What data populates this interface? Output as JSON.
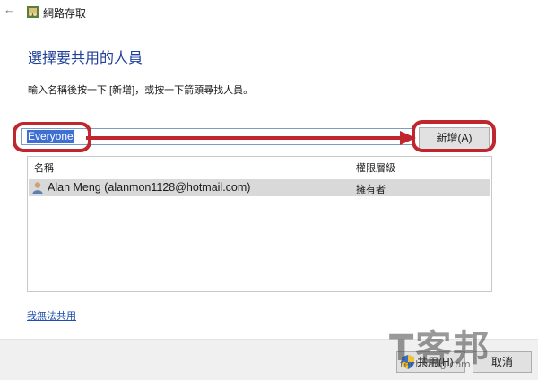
{
  "titlebar": {
    "back_glyph": "←",
    "title": "網路存取"
  },
  "heading": "選擇要共用的人員",
  "instruction": "輸入名稱後按一下 [新增]，或按一下箭頭尋找人員。",
  "name_input": {
    "value": "Everyone"
  },
  "add_button_label": "新增(A)",
  "table": {
    "columns": [
      "名稱",
      "權限層級"
    ],
    "rows": [
      {
        "name": "Alan Meng (alanmon1128@hotmail.com)",
        "permission": "擁有者"
      }
    ]
  },
  "trouble_link": "我無法共用",
  "footer": {
    "share_label": "共用(H)",
    "cancel_label": "取消"
  },
  "watermark": {
    "big": "T客邦",
    "small": "techbang.com"
  },
  "colors": {
    "highlight": "#c0262d",
    "heading": "#1f3f99",
    "selection": "#3f6fd4"
  },
  "icons": {
    "back": "back-arrow-icon",
    "app": "network-share-icon",
    "user": "user-icon",
    "shield": "uac-shield-icon"
  }
}
